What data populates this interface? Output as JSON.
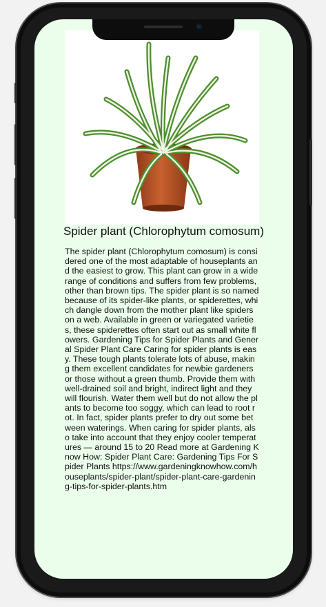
{
  "image": {
    "subject": "spider-plant-in-pot",
    "colors": {
      "pot": "#b4532a",
      "leaf_green": "#4f8f2f",
      "leaf_stripe": "#f1f4e6"
    }
  },
  "caption": "Spider plant (Chlorophytum comosum)",
  "description": "The spider plant (Chlorophytum comosum) is considered one of the most adaptable of houseplants and the easiest to grow. This plant can grow in a wide range of conditions and suffers from few problems, other than brown tips. The spider plant is so named because of its spider-like plants, or spiderettes, which dangle down from the mother plant like spiders on a web. Available in green or variegated varieties, these spiderettes often start out as small white flowers. Gardening Tips for Spider Plants and General Spider Plant Care Caring for spider plants is easy. These tough plants tolerate lots of abuse, making them excellent candidates for newbie gardeners or those without a green thumb. Provide them with well-drained soil and bright, indirect light and they will flourish. Water them well but do not allow the plants to become too soggy, which can lead to root rot. In fact, spider plants prefer to dry out some between waterings. When caring for spider plants, also take into account that they enjoy cooler temperatures — around 15 to 20 Read more at Gardening Know How: Spider Plant Care: Gardening Tips For Spider Plants https://www.gardeningknowhow.com/houseplants/spider-plant/spider-plant-care-gardening-tips-for-spider-plants.htm",
  "colors": {
    "screen_bg": "#ebfdeb",
    "frame": "#0d0d0d"
  }
}
